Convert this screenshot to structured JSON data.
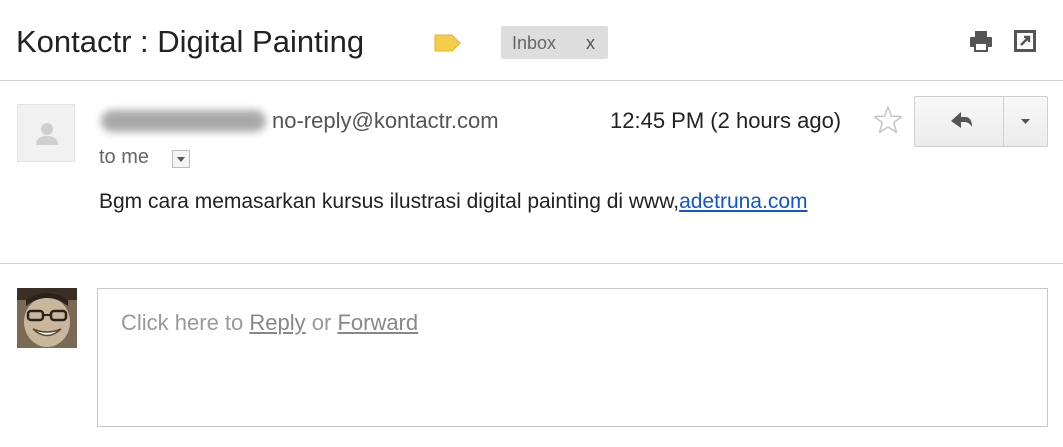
{
  "header": {
    "subject": "Kontactr : Digital Painting",
    "label_chip": "Inbox",
    "label_chip_remove": "x",
    "label_color": "#f6cd4b"
  },
  "message": {
    "sender_email": "no-reply@kontactr.com",
    "timestamp": "12:45 PM (2 hours ago)",
    "recipient": "to me",
    "body_prefix": "Bgm cara memasarkan kursus ilustrasi digital painting di www,",
    "body_link": "adetruna.com"
  },
  "reply": {
    "prompt_prefix": "Click here to ",
    "reply_link": "Reply",
    "or_text": " or ",
    "forward_link": "Forward"
  },
  "icons": {
    "print": "print-icon",
    "new_window": "new-window-icon",
    "star": "star-icon",
    "reply": "reply-arrow-icon",
    "more": "caret-down-icon"
  }
}
